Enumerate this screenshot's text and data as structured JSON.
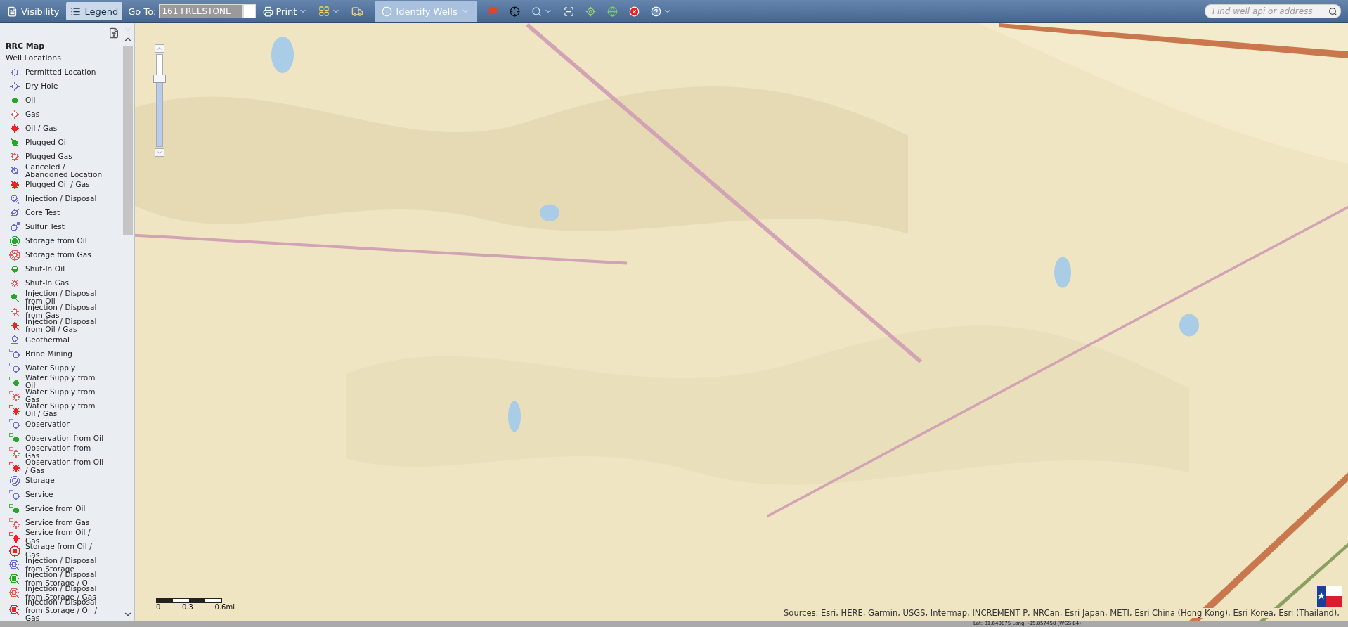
{
  "toolbar": {
    "tabs": [
      {
        "label": "Visibility",
        "selected": false
      },
      {
        "label": "Legend",
        "selected": true
      }
    ],
    "goto": {
      "label": "Go To:",
      "value": "161 FREESTONE"
    },
    "print": {
      "label": "Print"
    },
    "identify": {
      "label": "Identify Wells",
      "selected": true
    },
    "search": {
      "placeholder": "Find well api or address"
    }
  },
  "legend": {
    "title": "RRC Map",
    "group": "Well Locations",
    "items": [
      {
        "label": "Permitted Location",
        "kind": "open",
        "color": "#6b6bd6"
      },
      {
        "label": "Dry Hole",
        "kind": "dry",
        "color": "#6b6bd6"
      },
      {
        "label": "Oil",
        "kind": "dot",
        "color": "#2aa52a"
      },
      {
        "label": "Gas",
        "kind": "star",
        "color": "#e85a5a"
      },
      {
        "label": "Oil / Gas",
        "kind": "burst",
        "color": "#ee2222"
      },
      {
        "label": "Plugged Oil",
        "kind": "plugged-dot",
        "color": "#2aa52a"
      },
      {
        "label": "Plugged Gas",
        "kind": "plugged-star",
        "color": "#e85a5a"
      },
      {
        "label": "Canceled / Abandoned Location",
        "kind": "canceled",
        "color": "#6b6bd6"
      },
      {
        "label": "Plugged Oil / Gas",
        "kind": "plugged-burst",
        "color": "#ee2222"
      },
      {
        "label": "Injection / Disposal",
        "kind": "injection",
        "color": "#6b6bd6"
      },
      {
        "label": "Core Test",
        "kind": "core",
        "color": "#6b6bd6"
      },
      {
        "label": "Sulfur Test",
        "kind": "sulfur",
        "color": "#6b6bd6"
      },
      {
        "label": "Storage from Oil",
        "kind": "ring-dot",
        "color": "#2aa52a"
      },
      {
        "label": "Storage from Gas",
        "kind": "ring-star",
        "color": "#e85a5a"
      },
      {
        "label": "Shut-In Oil",
        "kind": "half",
        "color": "#2aa52a"
      },
      {
        "label": "Shut-In Gas",
        "kind": "small-star",
        "color": "#e85a5a"
      },
      {
        "label": "Injection / Disposal from Oil",
        "kind": "inj-dot",
        "color": "#2aa52a"
      },
      {
        "label": "Injection / Disposal from Gas",
        "kind": "inj-star",
        "color": "#e85a5a"
      },
      {
        "label": "Injection / Disposal from Oil / Gas",
        "kind": "inj-burst",
        "color": "#ee2222"
      },
      {
        "label": "Geothermal",
        "kind": "diamond",
        "color": "#6b6bd6"
      },
      {
        "label": "Brine Mining",
        "kind": "tag-open",
        "color": "#6b6bd6"
      },
      {
        "label": "Water Supply",
        "kind": "tag-open",
        "color": "#6b6bd6"
      },
      {
        "label": "Water Supply from Oil",
        "kind": "tag-dot",
        "color": "#2aa52a"
      },
      {
        "label": "Water Supply from Gas",
        "kind": "tag-star",
        "color": "#e85a5a"
      },
      {
        "label": "Water Supply from Oil / Gas",
        "kind": "tag-burst",
        "color": "#ee2222"
      },
      {
        "label": "Observation",
        "kind": "tag-open",
        "color": "#6b6bd6"
      },
      {
        "label": "Observation from Oil",
        "kind": "tag-dot",
        "color": "#2aa52a"
      },
      {
        "label": "Observation from Gas",
        "kind": "tag-star",
        "color": "#e85a5a"
      },
      {
        "label": "Observation from Oil / Gas",
        "kind": "tag-burst",
        "color": "#ee2222"
      },
      {
        "label": "Storage",
        "kind": "double-ring",
        "color": "#6b6bd6"
      },
      {
        "label": "Service",
        "kind": "tag-open",
        "color": "#6b6bd6"
      },
      {
        "label": "Service from Oil",
        "kind": "tag-dot",
        "color": "#2aa52a"
      },
      {
        "label": "Service from Gas",
        "kind": "tag-star",
        "color": "#e85a5a"
      },
      {
        "label": "Service from Oil / Gas",
        "kind": "tag-burst",
        "color": "#ee2222"
      },
      {
        "label": "Storage from Oil / Gas",
        "kind": "ring-burst",
        "color": "#ee2222"
      },
      {
        "label": "Injection / Disposal from Storage",
        "kind": "ring-inj",
        "color": "#6b6bd6"
      },
      {
        "label": "Injection / Disposal from Storage / Oil",
        "kind": "ring-inj-dot",
        "color": "#2aa52a"
      },
      {
        "label": "Injection / Disposal from Storage / Gas",
        "kind": "ring-inj",
        "color": "#e85a5a"
      },
      {
        "label": "Injection / Disposal from Storage / Oil / Gas",
        "kind": "ring-inj-dot",
        "color": "#ee2222"
      }
    ]
  },
  "map": {
    "zoom_slider": {
      "level": 0.73
    },
    "scale_bar": {
      "labels": [
        "0",
        "0.3",
        "0.6mi"
      ]
    },
    "attribution": "Sources: Esri, HERE, Garmin, USGS, Intermap, INCREMENT P, NRCan, Esri Japan, METI, Esri China (Hong Kong), Esri Korea, Esri (Thailand),"
  },
  "status_bar": {
    "text": "Lat: 31.640875 Long: -95.857458 (WGS 84)"
  }
}
